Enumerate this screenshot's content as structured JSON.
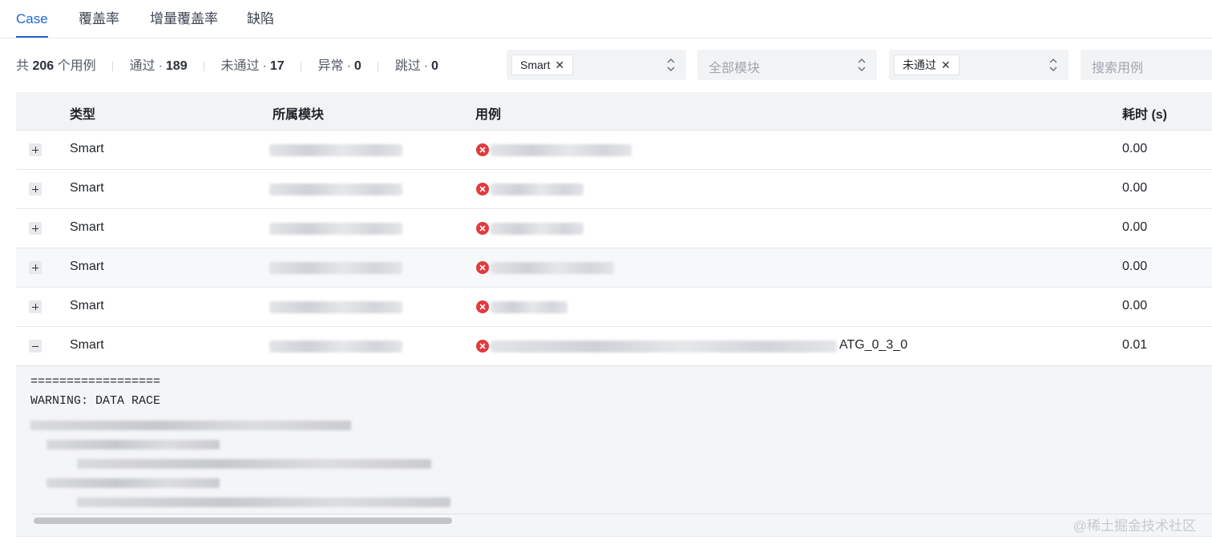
{
  "tabs": [
    {
      "label": "Case",
      "active": true
    },
    {
      "label": "覆盖率",
      "active": false
    },
    {
      "label": "增量覆盖率",
      "active": false
    },
    {
      "label": "缺陷",
      "active": false
    }
  ],
  "summary": {
    "total_prefix": "共",
    "total": "206",
    "total_suffix": "个用例",
    "passed_label": "通过",
    "passed": "189",
    "failed_label": "未通过",
    "failed": "17",
    "error_label": "异常",
    "error": "0",
    "skipped_label": "跳过",
    "skipped": "0",
    "dot": "·"
  },
  "filters": {
    "type_chip": "Smart",
    "module_placeholder": "全部模块",
    "status_chip": "未通过",
    "search_placeholder": "搜索用例",
    "remove_glyph": "✕"
  },
  "table": {
    "headers": {
      "type": "类型",
      "module": "所属模块",
      "case": "用例",
      "duration": "耗时 (s)"
    },
    "rows": [
      {
        "type": "Smart",
        "case_suffix": "",
        "duration": "0.00",
        "expanded": false
      },
      {
        "type": "Smart",
        "case_suffix": "",
        "duration": "0.00",
        "expanded": false
      },
      {
        "type": "Smart",
        "case_suffix": "",
        "duration": "0.00",
        "expanded": false
      },
      {
        "type": "Smart",
        "case_suffix": "",
        "duration": "0.00",
        "expanded": false
      },
      {
        "type": "Smart",
        "case_suffix": "",
        "duration": "0.00",
        "expanded": false
      },
      {
        "type": "Smart",
        "case_suffix": "ATG_0_3_0",
        "duration": "0.01",
        "expanded": true
      }
    ]
  },
  "log": {
    "line1": "==================",
    "line2": "WARNING: DATA RACE"
  },
  "watermark": "@稀土掘金技术社区",
  "colors": {
    "accent": "#1a66d6",
    "fail": "#e2393c"
  }
}
